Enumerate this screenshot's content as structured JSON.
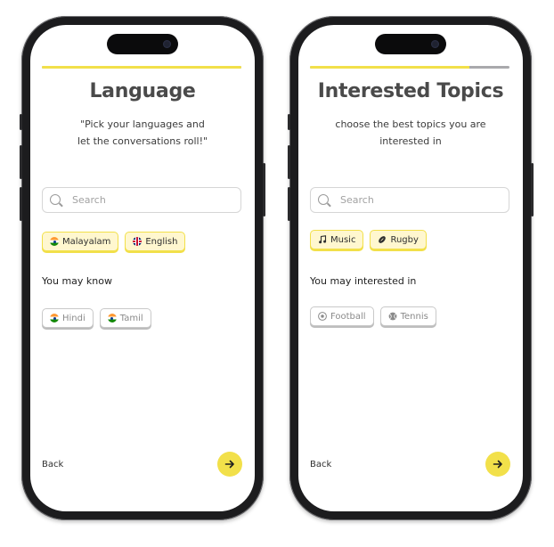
{
  "screen_language": {
    "progress": 1.0,
    "title": "Language",
    "subtitle_line1": "\"Pick your languages and",
    "subtitle_line2": "let the conversations roll!\"",
    "search_placeholder": "Search",
    "selected": [
      {
        "label": "Malayalam",
        "icon": "india-flag-icon"
      },
      {
        "label": "English",
        "icon": "uk-flag-icon"
      }
    ],
    "suggest_label": "You may know",
    "suggestions": [
      {
        "label": "Hindi",
        "icon": "india-flag-icon"
      },
      {
        "label": "Tamil",
        "icon": "india-flag-icon"
      }
    ],
    "back_label": "Back",
    "next_icon": "arrow-right-icon"
  },
  "screen_topics": {
    "progress": 0.8,
    "title": "Interested Topics",
    "subtitle_line1": "choose the best topics you are",
    "subtitle_line2": "interested in",
    "search_placeholder": "Search",
    "selected": [
      {
        "label": "Music",
        "icon": "music-note-icon"
      },
      {
        "label": "Rugby",
        "icon": "rugby-ball-icon"
      }
    ],
    "suggest_label": "You may interested in",
    "suggestions": [
      {
        "label": "Football",
        "icon": "football-icon"
      },
      {
        "label": "Tennis",
        "icon": "tennis-ball-icon"
      }
    ],
    "back_label": "Back",
    "next_icon": "arrow-right-icon"
  },
  "colors": {
    "accent": "#f2e04a",
    "selected_chip_bg": "#fff7cf",
    "title": "#4a4a4a",
    "phone_frame": "#1c1c1e"
  }
}
